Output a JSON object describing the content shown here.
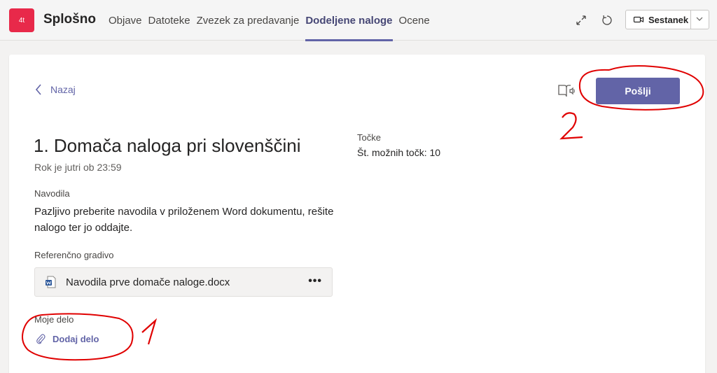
{
  "header": {
    "team_initials": "4t",
    "channel_name": "Splošno",
    "tabs": [
      {
        "label": "Objave",
        "active": false
      },
      {
        "label": "Datoteke",
        "active": false
      },
      {
        "label": "Zvezek za predavanje",
        "active": false
      },
      {
        "label": "Dodeljene naloge",
        "active": true
      },
      {
        "label": "Ocene",
        "active": false
      }
    ],
    "icons": [
      "expand-icon",
      "refresh-icon"
    ],
    "meeting_label": "Sestanek"
  },
  "assignment": {
    "back_label": "Nazaj",
    "submit_label": "Pošlji",
    "title": "1. Domača naloga pri slovenščini",
    "due": "Rok je jutri ob 23:59",
    "points_label": "Točke",
    "points_value": "Št. možnih točk: 10",
    "instructions_label": "Navodila",
    "instructions_text": "Pazljivo preberite navodila v priloženem Word dokumentu, rešite nalogo ter jo oddajte.",
    "reference_label": "Referenčno gradivo",
    "attachment_name": "Navodila prve domače naloge.docx",
    "attachment_more": "•••",
    "my_work_label": "Moje delo",
    "add_work_label": "Dodaj delo"
  },
  "colors": {
    "accent": "#6264a7",
    "team_avatar": "#e8294a",
    "annotation": "#e00000"
  }
}
